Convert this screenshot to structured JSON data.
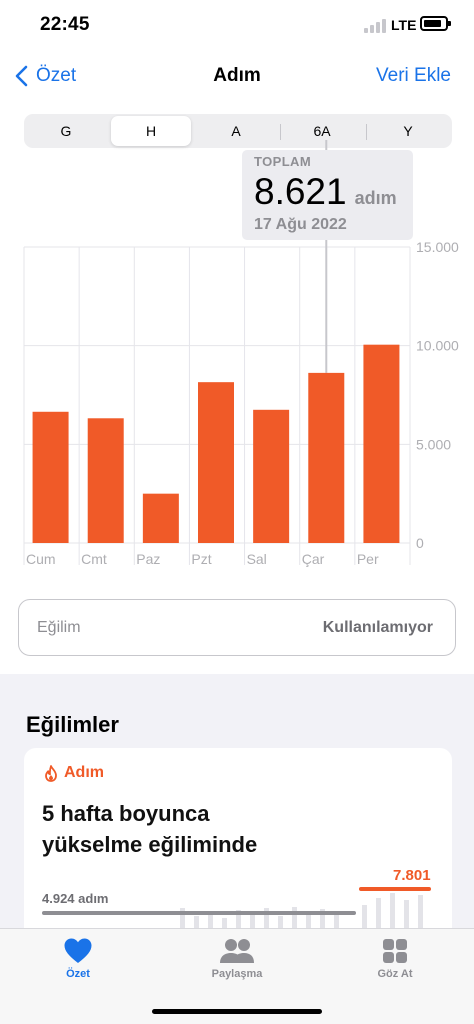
{
  "status_bar": {
    "time": "22:45",
    "network": "LTE"
  },
  "nav": {
    "back_label": "Özet",
    "title": "Adım",
    "action_label": "Veri Ekle"
  },
  "segments": [
    "G",
    "H",
    "A",
    "6A",
    "Y"
  ],
  "active_segment": "H",
  "tooltip": {
    "label": "TOPLAM",
    "value": "8.621",
    "unit": "adım",
    "date": "17 Ağu 2022"
  },
  "chart_data": {
    "type": "bar",
    "categories": [
      "Cum",
      "Cmt",
      "Paz",
      "Pzt",
      "Sal",
      "Çar",
      "Per"
    ],
    "values": [
      6650,
      6320,
      2500,
      8150,
      6750,
      8621,
      10050
    ],
    "ylim": [
      0,
      15000
    ],
    "yticks": [
      "15.000",
      "10.000",
      "5.000",
      "0"
    ],
    "highlighted_category": "Çar",
    "bar_color": "#f05a28",
    "grid": true
  },
  "trend_row": {
    "label": "Eğilim",
    "status": "Kullanılamıyor"
  },
  "trends_section": {
    "title": "Eğilimler",
    "card": {
      "category": "Adım",
      "text_line1": "5 hafta boyunca",
      "text_line2": "yükselme eğiliminde",
      "left_value": "4.924 adım",
      "right_value": "7.801"
    }
  },
  "tabs": [
    {
      "label": "Özet",
      "icon": "heart-icon"
    },
    {
      "label": "Paylaşma",
      "icon": "people-icon"
    },
    {
      "label": "Göz At",
      "icon": "grid-icon"
    }
  ],
  "colors": {
    "accent": "#1a73e8",
    "bar": "#f05a28"
  }
}
